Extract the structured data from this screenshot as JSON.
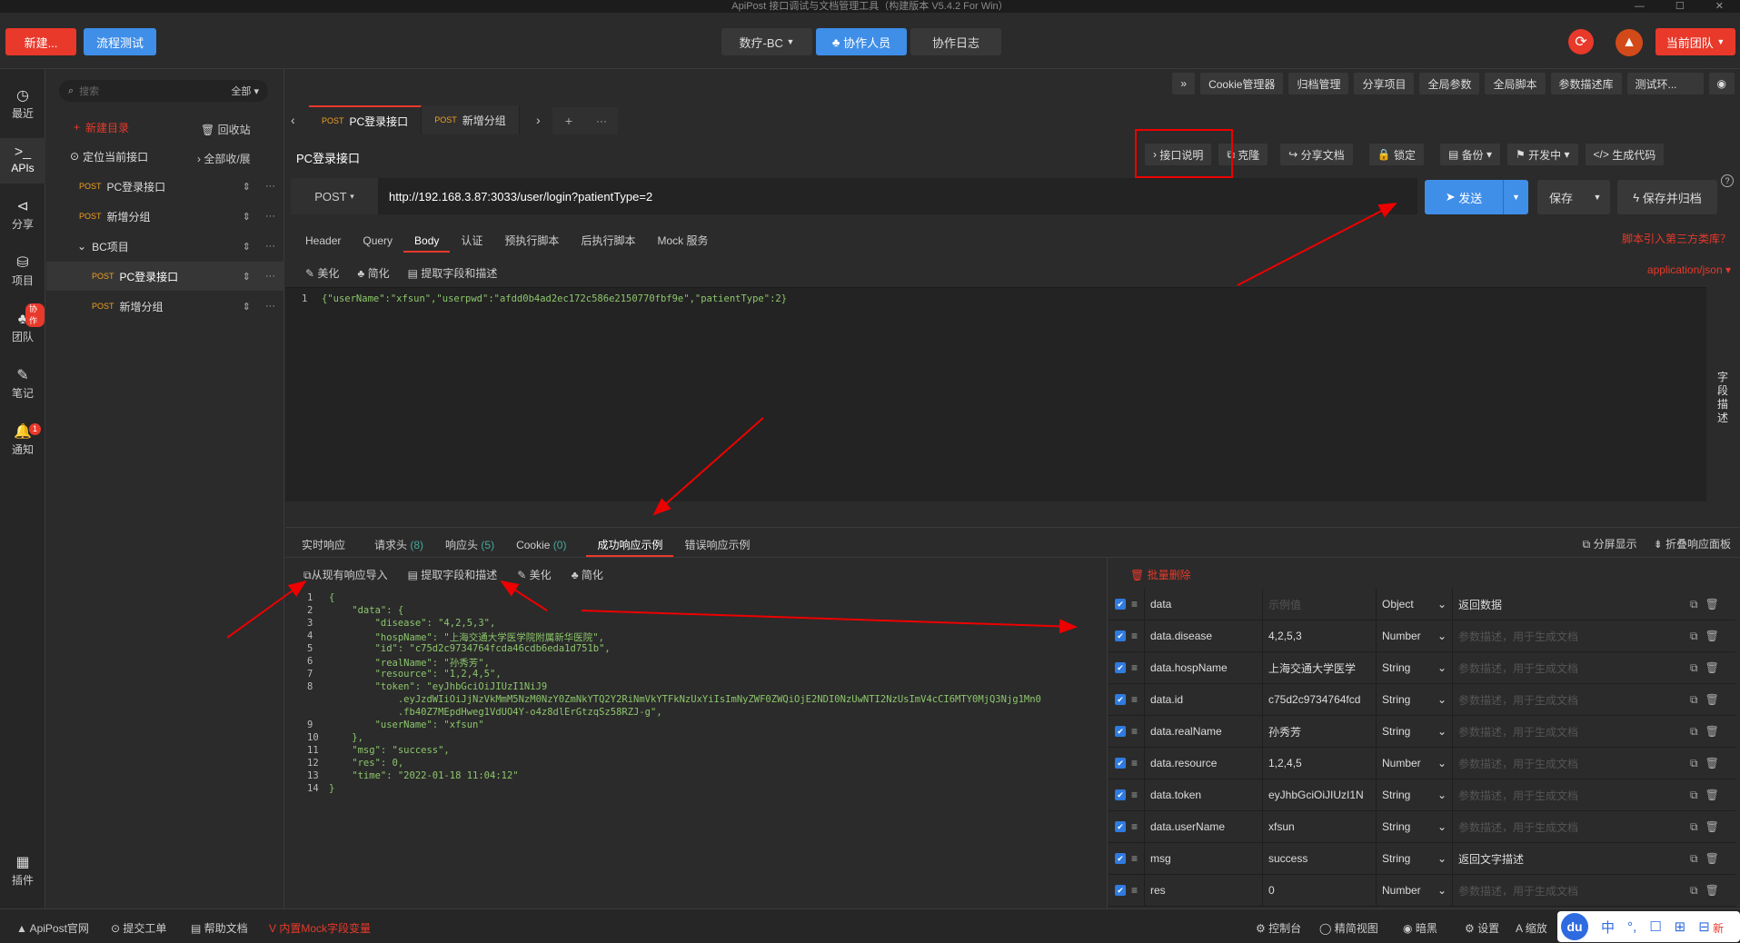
{
  "window": {
    "title": "ApiPost 接口调试与文档管理工具（构建版本 V5.4.2 For Win）",
    "controls": [
      "—",
      "☐",
      "✕"
    ]
  },
  "top": {
    "new_btn": "新建...",
    "flow_btn": "流程测试",
    "project_select": "数疗-BC",
    "collab_btn": "协作人员",
    "collab_log": "协作日志",
    "team_btn": "当前团队"
  },
  "leftnav": {
    "items": [
      {
        "label": "最近",
        "icon": "◷"
      },
      {
        "label": "APIs",
        "icon": ">_"
      },
      {
        "label": "分享",
        "icon": "⊲"
      },
      {
        "label": "项目",
        "icon": "⛁"
      },
      {
        "label": "团队",
        "icon": "♣",
        "badge": "协作"
      },
      {
        "label": "笔记",
        "icon": "✎"
      },
      {
        "label": "通知",
        "icon": "🔔",
        "badge": "1"
      },
      {
        "label": "插件",
        "icon": "▦"
      }
    ]
  },
  "tree": {
    "search_placeholder": "搜索",
    "filter": "全部",
    "new_dir": "新建目录",
    "recycle": "回收站",
    "locate": "定位当前接口",
    "collapse": "全部收/展",
    "rows": [
      {
        "method": "POST",
        "name": "PC登录接口"
      },
      {
        "method": "POST",
        "name": "新增分组"
      },
      {
        "method": "",
        "name": "BC项目"
      },
      {
        "method": "POST",
        "name": "PC登录接口"
      },
      {
        "method": "POST",
        "name": "新增分组"
      }
    ]
  },
  "toolbar": {
    "items": [
      "»",
      "Cookie管理器",
      "归档管理",
      "分享项目",
      "全局参数",
      "全局脚本",
      "参数描述库",
      "测试环...",
      "◉"
    ]
  },
  "tabs": [
    {
      "method": "POST",
      "name": "PC登录接口"
    },
    {
      "method": "POST",
      "name": "新增分组"
    }
  ],
  "tabs_extra": {
    "prev": "‹",
    "next": "›",
    "plus": "+",
    "more": "···"
  },
  "api": {
    "title": "PC登录接口",
    "actions": [
      "接口说明",
      "克隆",
      "分享文档",
      "锁定",
      "备份",
      "开发中",
      "生成代码"
    ],
    "method": "POST",
    "url": "http://192.168.3.87:3033/user/login?patientType=2",
    "send": "发送",
    "save": "保存",
    "save_archive": "保存并归档",
    "help": "?"
  },
  "request_tabs": [
    "Header",
    "Query",
    "Body",
    "认证",
    "预执行脚本",
    "后执行脚本",
    "Mock 服务"
  ],
  "request_tools": {
    "beautify": "美化",
    "simplify": "简化",
    "extract": "提取字段和描述",
    "lib_link": "脚本引入第三方类库？",
    "content_type": "application/json"
  },
  "body": {
    "line_no": "1",
    "text": "{\"userName\":\"xfsun\",\"userpwd\":\"afdd0b4ad2ec172c586e2150770fbf9e\",\"patientType\":2}"
  },
  "field_desc": "字段描述",
  "response_tabs": [
    {
      "label": "实时响应",
      "count": ""
    },
    {
      "label": "请求头",
      "count": "(8)"
    },
    {
      "label": "响应头",
      "count": "(5)"
    },
    {
      "label": "Cookie",
      "count": "(0)"
    },
    {
      "label": "成功响应示例",
      "count": ""
    },
    {
      "label": "错误响应示例",
      "count": ""
    }
  ],
  "response_right": {
    "split": "分屏显示",
    "fold": "折叠响应面板"
  },
  "response_tools": {
    "import": "从现有响应导入",
    "extract": "提取字段和描述",
    "beautify": "美化",
    "simplify": "简化",
    "batch_delete": "批量删除"
  },
  "response_code": [
    {
      "n": "1",
      "t": "{"
    },
    {
      "n": "2",
      "t": "    \"data\": {"
    },
    {
      "n": "3",
      "t": "        \"disease\": \"4,2,5,3\","
    },
    {
      "n": "4",
      "t": "        \"hospName\": \"上海交通大学医学院附属新华医院\","
    },
    {
      "n": "5",
      "t": "        \"id\": \"c75d2c9734764fcda46cdb6eda1d751b\","
    },
    {
      "n": "6",
      "t": "        \"realName\": \"孙秀芳\","
    },
    {
      "n": "7",
      "t": "        \"resource\": \"1,2,4,5\","
    },
    {
      "n": "8",
      "t": "        \"token\": \"eyJhbGciOiJIUzI1NiJ9"
    },
    {
      "n": "",
      "t": "            .eyJzdWIiOiJjNzVkMmM5NzM0NzY0ZmNkYTQ2Y2RiNmVkYTFkNzUxYiIsImNyZWF0ZWQiOjE2NDI0NzUwNTI2NzUsImV4cCI6MTY0MjQ3Njg1Mn0"
    },
    {
      "n": "",
      "t": "            .fb40Z7MEpdHweg1VdUO4Y-o4z8dlErGtzqSz58RZJ-g\","
    },
    {
      "n": "9",
      "t": "        \"userName\": \"xfsun\""
    },
    {
      "n": "10",
      "t": "    },"
    },
    {
      "n": "11",
      "t": "    \"msg\": \"success\","
    },
    {
      "n": "12",
      "t": "    \"res\": 0,"
    },
    {
      "n": "13",
      "t": "    \"time\": \"2022-01-18 11:04:12\""
    },
    {
      "n": "14",
      "t": "}"
    }
  ],
  "fields": [
    {
      "key": "data",
      "value": "示例值",
      "type": "Object",
      "desc": "返回数据"
    },
    {
      "key": "data.disease",
      "value": "4,2,5,3",
      "type": "Number",
      "desc": "参数描述，用于生成文档"
    },
    {
      "key": "data.hospName",
      "value": "上海交通大学医学",
      "type": "String",
      "desc": "参数描述，用于生成文档"
    },
    {
      "key": "data.id",
      "value": "c75d2c9734764fcd",
      "type": "String",
      "desc": "参数描述，用于生成文档"
    },
    {
      "key": "data.realName",
      "value": "孙秀芳",
      "type": "String",
      "desc": "参数描述，用于生成文档"
    },
    {
      "key": "data.resource",
      "value": "1,2,4,5",
      "type": "Number",
      "desc": "参数描述，用于生成文档"
    },
    {
      "key": "data.token",
      "value": "eyJhbGciOiJIUzI1N",
      "type": "String",
      "desc": "参数描述，用于生成文档"
    },
    {
      "key": "data.userName",
      "value": "xfsun",
      "type": "String",
      "desc": "参数描述，用于生成文档"
    },
    {
      "key": "msg",
      "value": "success",
      "type": "String",
      "desc": "返回文字描述"
    },
    {
      "key": "res",
      "value": "0",
      "type": "Number",
      "desc": "参数描述，用于生成文档"
    }
  ],
  "status": {
    "left": [
      "ApiPost官网",
      "提交工单",
      "帮助文档",
      "内置Mock字段变量"
    ],
    "right": [
      "控制台",
      "精简视图",
      "暗黑",
      "设置",
      "缩放",
      "新"
    ],
    "ime": [
      "du",
      "中",
      "°,",
      "☐",
      "⊞",
      "⊟"
    ]
  },
  "colors": {
    "accent": "#e8392b",
    "blue": "#3f8ee8",
    "post": "#f0a020",
    "bg": "#2b2b2b"
  }
}
